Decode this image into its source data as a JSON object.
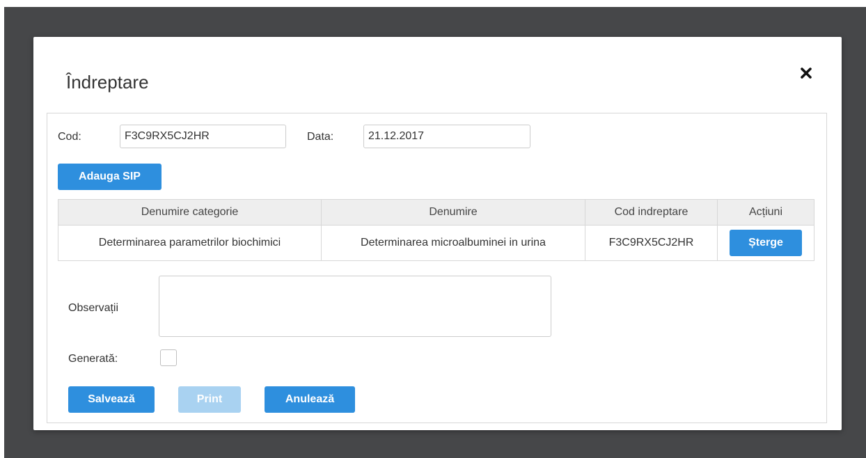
{
  "modal": {
    "title": "Îndreptare",
    "close_icon": "close-icon"
  },
  "form": {
    "cod_label": "Cod:",
    "cod_value": "F3C9RX5CJ2HR",
    "data_label": "Data:",
    "data_value": "21.12.2017",
    "add_sip_label": "Adauga SIP",
    "observatii_label": "Observații",
    "observatii_value": "",
    "generata_label": "Generată:",
    "generata_checked": false
  },
  "table": {
    "headers": [
      "Denumire categorie",
      "Denumire",
      "Cod indreptare",
      "Acțiuni"
    ],
    "rows": [
      {
        "categorie": "Determinarea parametrilor biochimici",
        "denumire": "Determinarea microalbuminei in urina",
        "cod": "F3C9RX5CJ2HR",
        "action_label": "Șterge"
      }
    ]
  },
  "footer": {
    "save_label": "Salvează",
    "print_label": "Print",
    "cancel_label": "Anulează"
  },
  "colors": {
    "accent": "#2e8fde",
    "accent_disabled": "#a9d2f1",
    "backdrop": "#464749",
    "header_bg": "#eeeeee",
    "border": "#d7d7d7"
  }
}
